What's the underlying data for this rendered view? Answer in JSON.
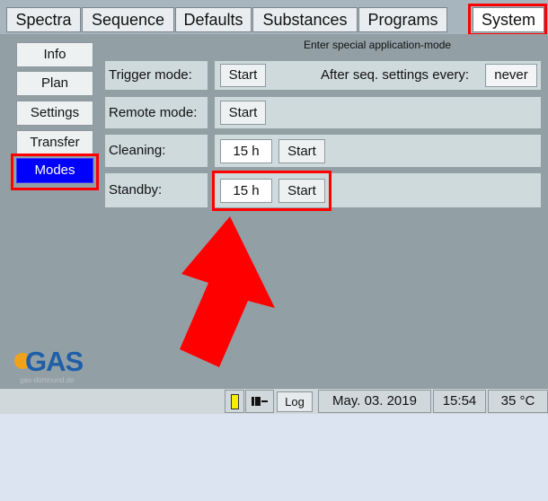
{
  "tabs": [
    "Spectra",
    "Sequence",
    "Defaults",
    "Substances",
    "Programs",
    "System"
  ],
  "header_text": "Enter special application-mode",
  "side_menu": [
    "Info",
    "Plan",
    "Settings",
    "Transfer",
    "Modes"
  ],
  "rows": {
    "trigger": {
      "label": "Trigger mode:",
      "start": "Start",
      "after_label": "After seq. settings every:",
      "after_value": "never"
    },
    "remote": {
      "label": "Remote mode:",
      "start": "Start"
    },
    "cleaning": {
      "label": "Cleaning:",
      "value": "15 h",
      "start": "Start"
    },
    "standby": {
      "label": "Standby:",
      "value": "15 h",
      "start": "Start"
    }
  },
  "logo": {
    "text": "GAS",
    "url": "gas-dortmund.de"
  },
  "status": {
    "log": "Log",
    "date": "May. 03. 2019",
    "time": "15:54",
    "temp": "35 °C"
  },
  "colors": {
    "active": "#0000ff",
    "highlight": "#ff0000",
    "logo_blue": "#1f5fa8",
    "logo_orange": "#f0a21b"
  },
  "icons": [
    "indicator-icon",
    "plug-icon",
    "arrow-icon"
  ]
}
